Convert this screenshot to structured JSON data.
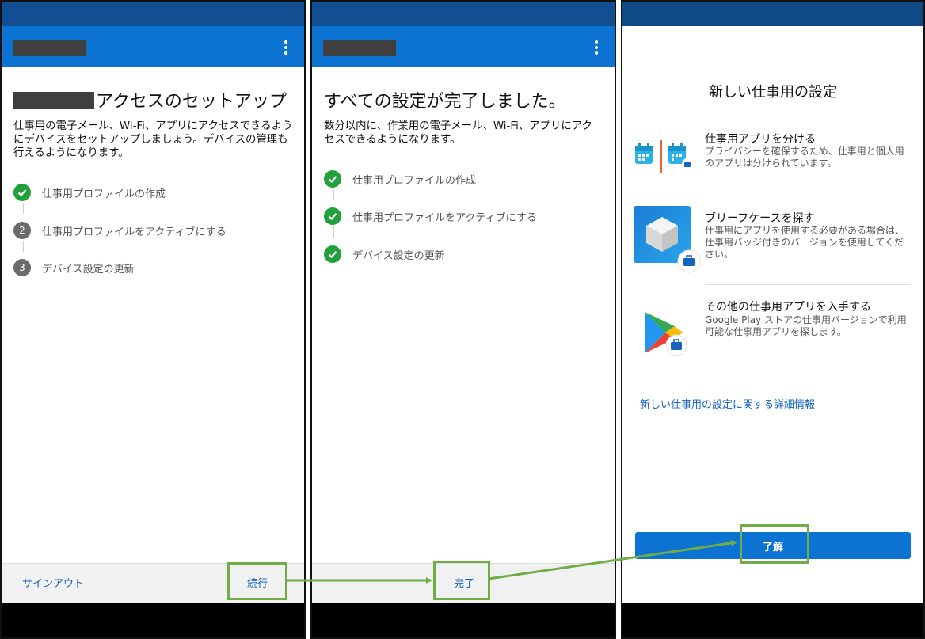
{
  "screen1": {
    "title": "アクセスのセットアップ",
    "description": "仕事用の電子メール、Wi-Fi、アプリにアクセスできるようにデバイスをセットアップしましょう。デバイスの管理も行えるようになります。",
    "steps": [
      {
        "marker": "",
        "label": "仕事用プロファイルの作成",
        "state": "done"
      },
      {
        "marker": "2",
        "label": "仕事用プロファイルをアクティブにする",
        "state": "pending"
      },
      {
        "marker": "3",
        "label": "デバイス設定の更新",
        "state": "pending"
      }
    ],
    "sign_out_label": "サインアウト",
    "continue_label": "続行"
  },
  "screen2": {
    "title": "すべての設定が完了しました。",
    "description": "数分以内に、作業用の電子メール、Wi-Fi、アプリにアクセスできるようになります。",
    "steps": [
      {
        "label": "仕事用プロファイルの作成",
        "state": "done"
      },
      {
        "label": "仕事用プロファイルをアクティブにする",
        "state": "done"
      },
      {
        "label": "デバイス設定の更新",
        "state": "done"
      }
    ],
    "done_label": "完了"
  },
  "screen3": {
    "title": "新しい仕事用の設定",
    "features": [
      {
        "icon": "calendar-split-icon",
        "title": "仕事用アプリを分ける",
        "description": "プライバシーを確保するため、仕事用と個人用のアプリは分けられています。"
      },
      {
        "icon": "briefcase-cube-icon",
        "title": "ブリーフケースを探す",
        "description": "仕事用にアプリを使用する必要がある場合は、仕事用バッジ付きのバージョンを使用してください。"
      },
      {
        "icon": "google-play-icon",
        "title": "その他の仕事用アプリを入手する",
        "description": "Google Play ストアの仕事用バージョンで利用可能な仕事用アプリを探します。"
      }
    ],
    "link_text": "新しい仕事用の設定に関する詳細情報",
    "ok_label": "了解"
  },
  "colors": {
    "status_bar": "#124f92",
    "app_bar": "#0c73d2",
    "check_green": "#21a03b",
    "link_blue": "#1565c0",
    "highlight_green": "#70ad47"
  }
}
